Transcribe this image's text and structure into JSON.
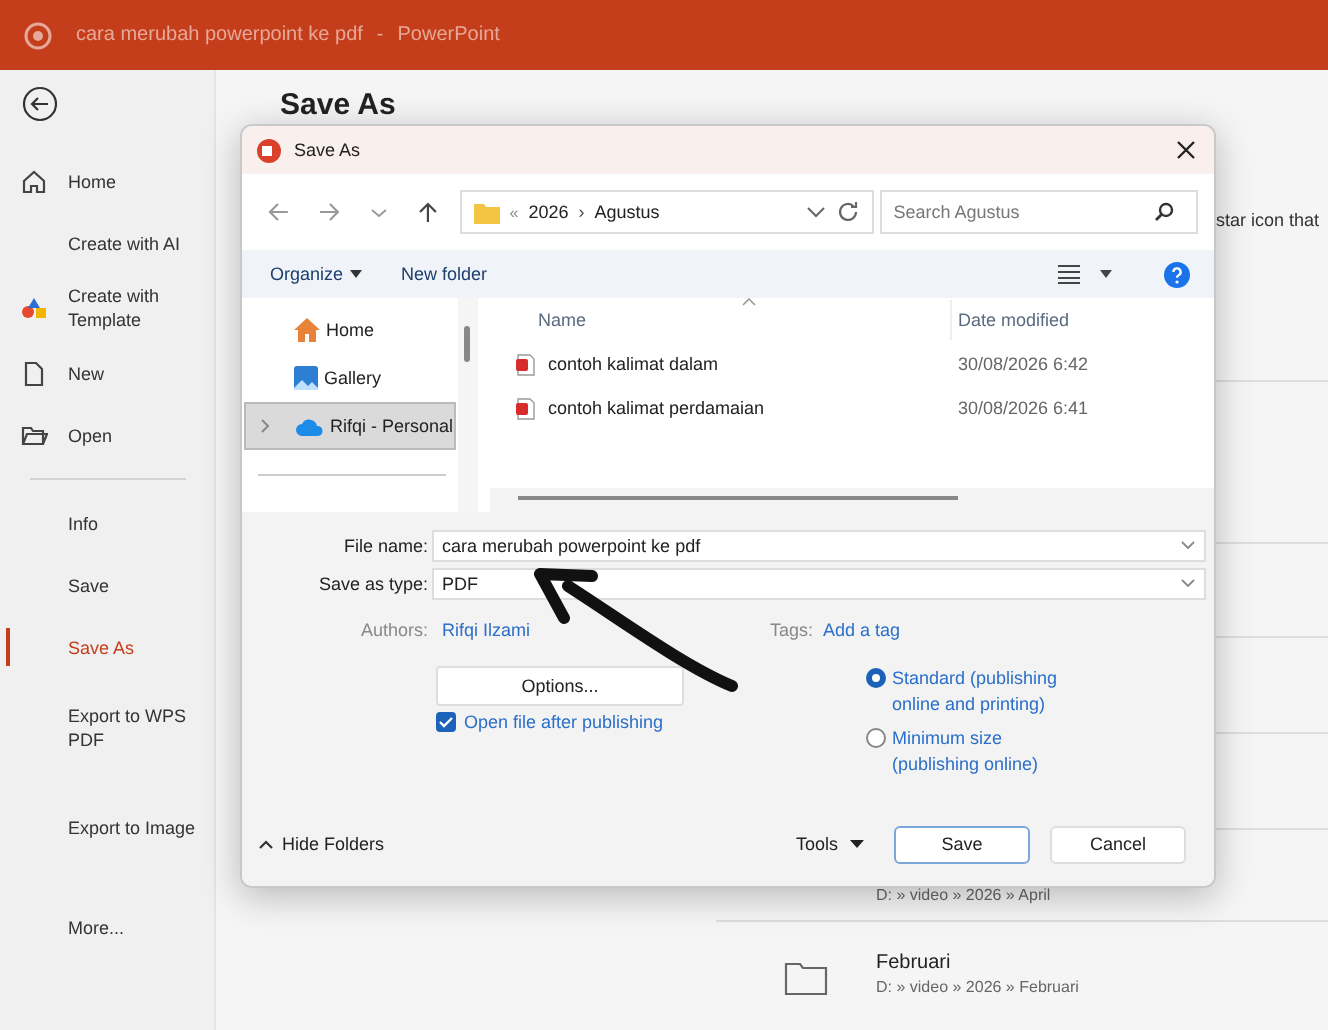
{
  "app_title": {
    "document": "cara merubah powerpoint ke pdf",
    "separator": "-",
    "app": "PowerPoint"
  },
  "sidebar": {
    "top": [
      {
        "label": "Home",
        "kind": "home",
        "selected": false
      },
      {
        "label": "Create with AI",
        "kind": "plain",
        "selected": false
      },
      {
        "label": "Create with Template",
        "kind": "template",
        "selected": false
      },
      {
        "label": "New",
        "kind": "new",
        "selected": false
      },
      {
        "label": "Open",
        "kind": "open",
        "selected": false
      }
    ],
    "bottom": [
      {
        "label": "Info",
        "selected": false
      },
      {
        "label": "Save",
        "selected": false
      },
      {
        "label": "Save As",
        "selected": true
      },
      {
        "label": "Export to WPS PDF",
        "selected": false
      },
      {
        "label": "Export to Image",
        "selected": false
      },
      {
        "label": "More...",
        "selected": false
      }
    ]
  },
  "page": {
    "heading": "Save As",
    "hint": "star icon that",
    "recent": [
      {
        "path": "D: » video » 2026 » April"
      },
      {
        "name": "Februari",
        "path": "D: » video » 2026 » Februari"
      }
    ]
  },
  "dialog": {
    "title": "Save As",
    "address": {
      "overflow": "«",
      "parts": [
        "2026",
        "Agustus"
      ],
      "separator": "›"
    },
    "search": {
      "placeholder": "Search Agustus"
    },
    "commands": {
      "organize": "Organize",
      "new_folder": "New folder"
    },
    "nav": [
      {
        "label": "Home",
        "kind": "home",
        "selected": false
      },
      {
        "label": "Gallery",
        "kind": "gallery",
        "selected": false
      },
      {
        "label": "Rifqi - Personal",
        "kind": "cloud",
        "selected": true
      }
    ],
    "columns": [
      "Name",
      "Date modified"
    ],
    "files": [
      {
        "name": "contoh kalimat dalam",
        "date": "30/08/2026 6:42"
      },
      {
        "name": "contoh kalimat perdamaian",
        "date": "30/08/2026 6:41"
      }
    ],
    "file_name": {
      "label": "File name:",
      "value": "cara merubah powerpoint ke pdf"
    },
    "save_type": {
      "label": "Save as type:",
      "value": "PDF"
    },
    "authors": {
      "label": "Authors:",
      "value": "Rifqi Ilzami"
    },
    "tags": {
      "label": "Tags:",
      "value": "Add a tag"
    },
    "options_button": "Options...",
    "open_after": {
      "label": "Open file after publishing",
      "checked": true
    },
    "optimize": [
      {
        "label": "Standard (publishing online and printing)",
        "selected": true
      },
      {
        "label": "Minimum size (publishing online)",
        "selected": false
      }
    ],
    "hide_folders": "Hide Folders",
    "tools": "Tools",
    "save": "Save",
    "cancel": "Cancel"
  }
}
